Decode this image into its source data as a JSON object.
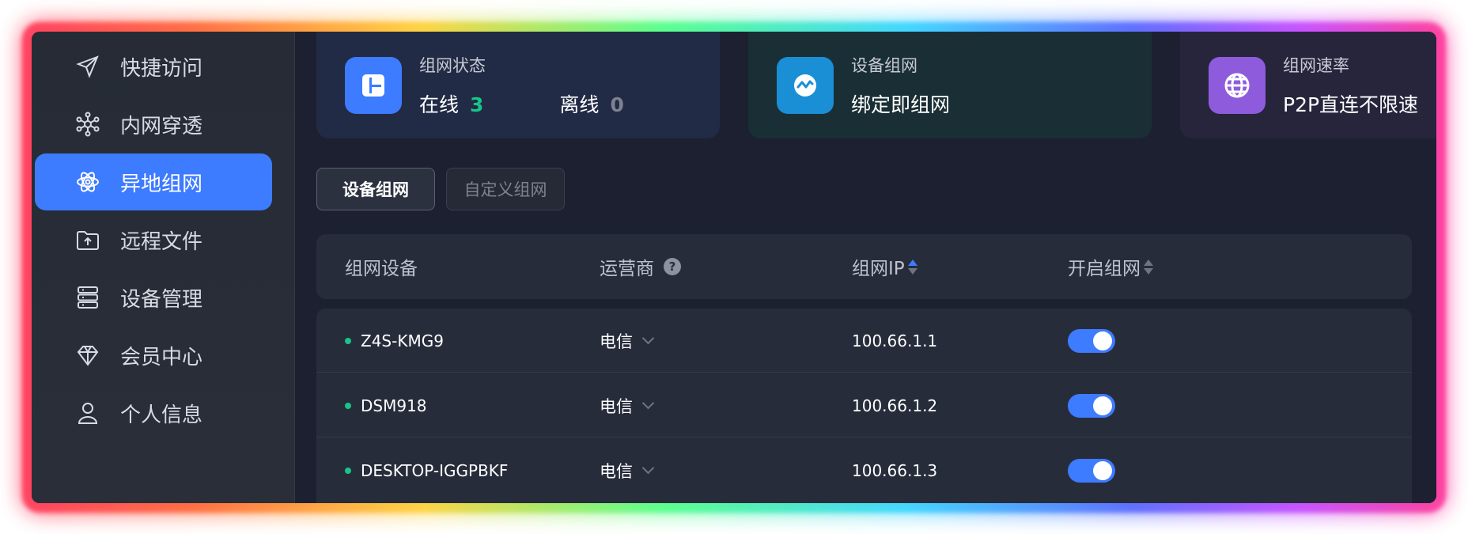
{
  "sidebar": {
    "items": [
      {
        "label": "快捷访问",
        "icon": "send-icon",
        "active": false
      },
      {
        "label": "内网穿透",
        "icon": "network-hub-icon",
        "active": false
      },
      {
        "label": "异地组网",
        "icon": "atom-icon",
        "active": true
      },
      {
        "label": "远程文件",
        "icon": "folder-upload-icon",
        "active": false
      },
      {
        "label": "设备管理",
        "icon": "server-icon",
        "active": false
      },
      {
        "label": "会员中心",
        "icon": "diamond-icon",
        "active": false
      },
      {
        "label": "个人信息",
        "icon": "user-icon",
        "active": false
      }
    ]
  },
  "cards": {
    "status": {
      "title": "组网状态",
      "online_label": "在线",
      "online_count": "3",
      "offline_label": "离线",
      "offline_count": "0",
      "icon": "layout-icon",
      "color": "#3d7bff"
    },
    "device": {
      "title": "设备组网",
      "value": "绑定即组网",
      "icon": "pulse-icon",
      "color": "#1a8fd6"
    },
    "speed": {
      "title": "组网速率",
      "value": "P2P直连不限速",
      "icon": "globe-icon",
      "color": "#8e5bdd"
    }
  },
  "tabs": [
    {
      "label": "设备组网",
      "active": true
    },
    {
      "label": "自定义组网",
      "active": false
    }
  ],
  "table": {
    "columns": [
      "组网设备",
      "运营商",
      "组网IP",
      "开启组网"
    ],
    "help_mark": "?",
    "rows": [
      {
        "device": "Z4S-KMG9",
        "carrier": "电信",
        "ip": "100.66.1.1",
        "enabled": true
      },
      {
        "device": "DSM918",
        "carrier": "电信",
        "ip": "100.66.1.2",
        "enabled": true
      },
      {
        "device": "DESKTOP-IGGPBKF",
        "carrier": "电信",
        "ip": "100.66.1.3",
        "enabled": true
      }
    ]
  },
  "colors": {
    "accent": "#3d7bff",
    "online": "#19c48a"
  }
}
